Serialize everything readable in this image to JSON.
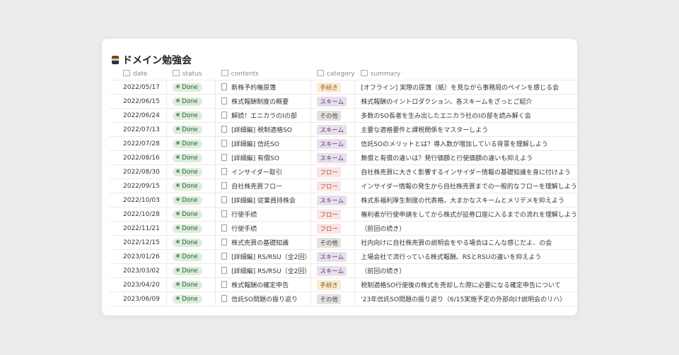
{
  "title": "ドメイン勉強会",
  "columns": [
    {
      "label": "date",
      "icon": "calendar-icon"
    },
    {
      "label": "status",
      "icon": "status-icon"
    },
    {
      "label": "contents",
      "icon": "text-icon",
      "prefix": "Aa"
    },
    {
      "label": "category",
      "icon": "list-icon"
    },
    {
      "label": "summary",
      "icon": "lines-icon"
    }
  ],
  "tag_colors": {
    "手続き": [
      "#fbecd5",
      "#8a5a1c"
    ],
    "スキーム": [
      "#e8deee",
      "#5a3e6b"
    ],
    "その他": [
      "#e3e2e0",
      "#4a4845"
    ],
    "フロー": [
      "#fbe4e4",
      "#a0483c"
    ]
  },
  "rows": [
    {
      "date": "2022/05/17",
      "status": "Done",
      "contents": "新株予約権原簿",
      "category": "手続き",
      "summary": "[オフライン] 実際の原簿（紙）を見ながら事務局のペインを感じる会"
    },
    {
      "date": "2022/06/15",
      "status": "Done",
      "contents": "株式報酬制度の概要",
      "category": "スキーム",
      "summary": "株式報酬のイントロダクション。各スキームをざっとご紹介"
    },
    {
      "date": "2022/06/24",
      "status": "Done",
      "contents": "解読！エニカラのIの部",
      "category": "その他",
      "summary": "多数のSO長者を生み出したエニカラ社のIの部を読み解く会"
    },
    {
      "date": "2022/07/13",
      "status": "Done",
      "contents": "[詳細編] 税制適格SO",
      "category": "スキーム",
      "summary": "主要な適格要件と課税関係をマスターしよう"
    },
    {
      "date": "2022/07/28",
      "status": "Done",
      "contents": "[詳細編] 信託SO",
      "category": "スキーム",
      "summary": "信託SOのメリットとは？導入数が増加している背景を理解しよう"
    },
    {
      "date": "2022/08/16",
      "status": "Done",
      "contents": "[詳細編] 有償SO",
      "category": "スキーム",
      "summary": "無償と有償の違いは？発行価額と行使価額の違いも抑えよう"
    },
    {
      "date": "2022/08/30",
      "status": "Done",
      "contents": "インサイダー取引",
      "category": "フロー",
      "summary": "自社株売買に大きく影響するインサイダー情報の基礎知識を身に付けよう"
    },
    {
      "date": "2022/09/15",
      "status": "Done",
      "contents": "自社株売買フロー",
      "category": "フロー",
      "summary": "インサイダー情報の発生から自社株売買までの一般的なフローを理解しよう"
    },
    {
      "date": "2022/10/03",
      "status": "Done",
      "contents": "[詳細編] 従業員持株会",
      "category": "スキーム",
      "summary": "株式系福利厚生制度の代表格。大まかなスキームとメリデメを抑えよう"
    },
    {
      "date": "2022/10/28",
      "status": "Done",
      "contents": "行使手続",
      "category": "フロー",
      "summary": "権利者が行使申請をしてから株式が証券口座に入るまでの流れを理解しよう"
    },
    {
      "date": "2022/11/21",
      "status": "Done",
      "contents": "行使手続",
      "category": "フロー",
      "summary": "（前回の続き）"
    },
    {
      "date": "2022/12/15",
      "status": "Done",
      "contents": "株式売買の基礎知識",
      "category": "その他",
      "summary": "社内向けに自社株売買の説明会をやる場合はこんな感じだよ、の会"
    },
    {
      "date": "2023/01/26",
      "status": "Done",
      "contents": "[詳細編] RS/RSU（全2回）",
      "category": "スキーム",
      "summary": "上場会社で流行っている株式報酬。RSとRSUの違いを抑えよう"
    },
    {
      "date": "2023/03/02",
      "status": "Done",
      "contents": "[詳細編] RS/RSU（全2回）",
      "category": "スキーム",
      "summary": "（前回の続き）"
    },
    {
      "date": "2023/04/20",
      "status": "Done",
      "contents": "株式報酬の確定申告",
      "category": "手続き",
      "summary": "税制適格SO行使後の株式を売却した際に必要になる確定申告について"
    },
    {
      "date": "2023/06/09",
      "status": "Done",
      "contents": "信託SO問題の振り返り",
      "category": "その他",
      "summary": "'23年信託SO問題の振り返り（6/15実施予定の外部向け説明会のリハ）"
    }
  ]
}
